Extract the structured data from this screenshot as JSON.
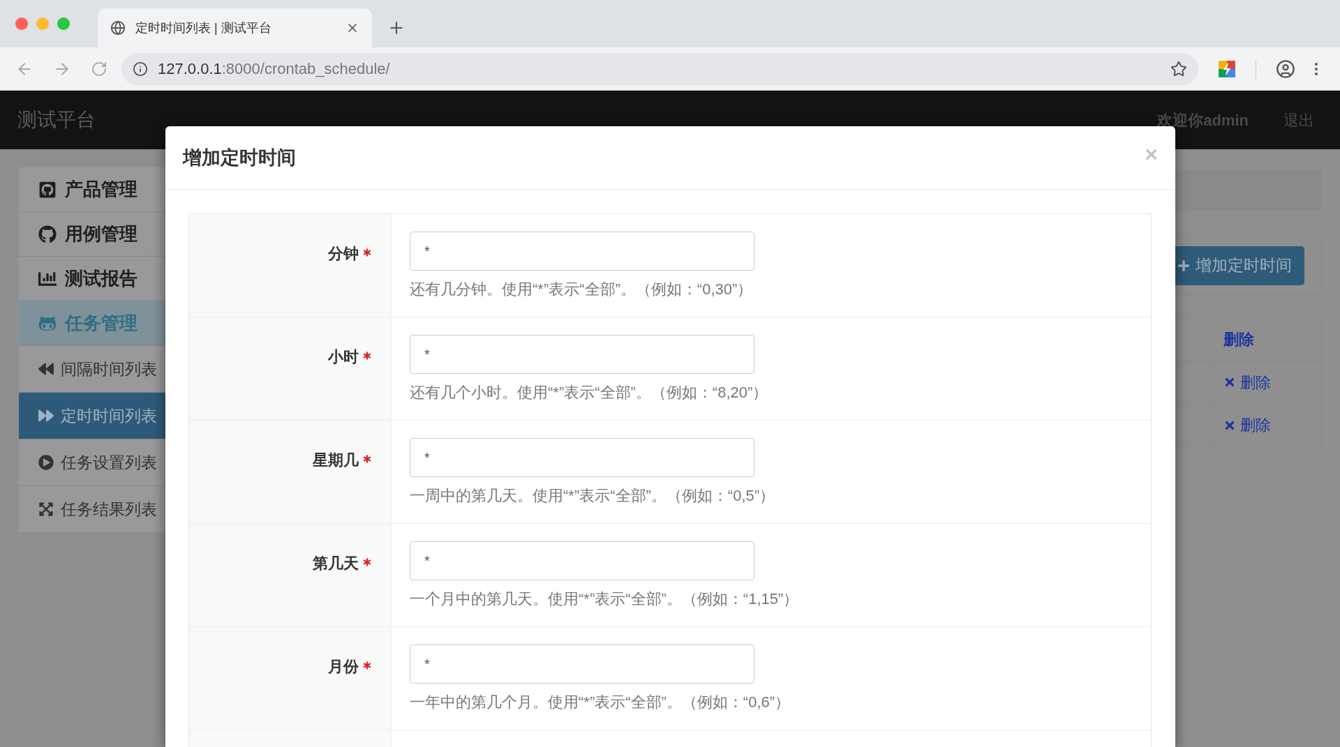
{
  "browser": {
    "tab_title": "定时时间列表 | 测试平台",
    "url_host": "127.0.0.1",
    "url_path": ":8000/crontab_schedule/"
  },
  "navbar": {
    "brand": "测试平台",
    "user": "欢迎你admin",
    "logout": "退出"
  },
  "sidebar": [
    {
      "label": "产品管理",
      "active": false
    },
    {
      "label": "用例管理",
      "active": false
    },
    {
      "label": "测试报告",
      "active": false
    },
    {
      "label": "任务管理",
      "active": true,
      "children": [
        {
          "label": "间隔时间列表",
          "selected": false
        },
        {
          "label": "定时时间列表",
          "selected": true
        },
        {
          "label": "任务设置列表",
          "selected": false
        },
        {
          "label": "任务结果列表",
          "selected": false
        }
      ]
    }
  ],
  "add_button": "增加定时时间",
  "table": {
    "header": "删除",
    "rows": [
      {
        "action": "删除"
      },
      {
        "action": "删除"
      }
    ]
  },
  "modal": {
    "title": "增加定时时间",
    "close": "×",
    "fields": [
      {
        "label": "分钟",
        "required": true,
        "value": "*",
        "help": "还有几分钟。使用“*”表示“全部”。（例如：“0,30”）"
      },
      {
        "label": "小时",
        "required": true,
        "value": "*",
        "help": "还有几个小时。使用“*”表示“全部”。（例如：“8,20”）"
      },
      {
        "label": "星期几",
        "required": true,
        "value": "*",
        "help": "一周中的第几天。使用“*”表示“全部”。（例如：“0,5”）"
      },
      {
        "label": "第几天",
        "required": true,
        "value": "*",
        "help": "一个月中的第几天。使用“*”表示“全部”。（例如：“1,15”）"
      },
      {
        "label": "月份",
        "required": true,
        "value": "*",
        "help": "一年中的第几个月。使用“*”表示“全部”。（例如：“0,6”）"
      }
    ]
  }
}
